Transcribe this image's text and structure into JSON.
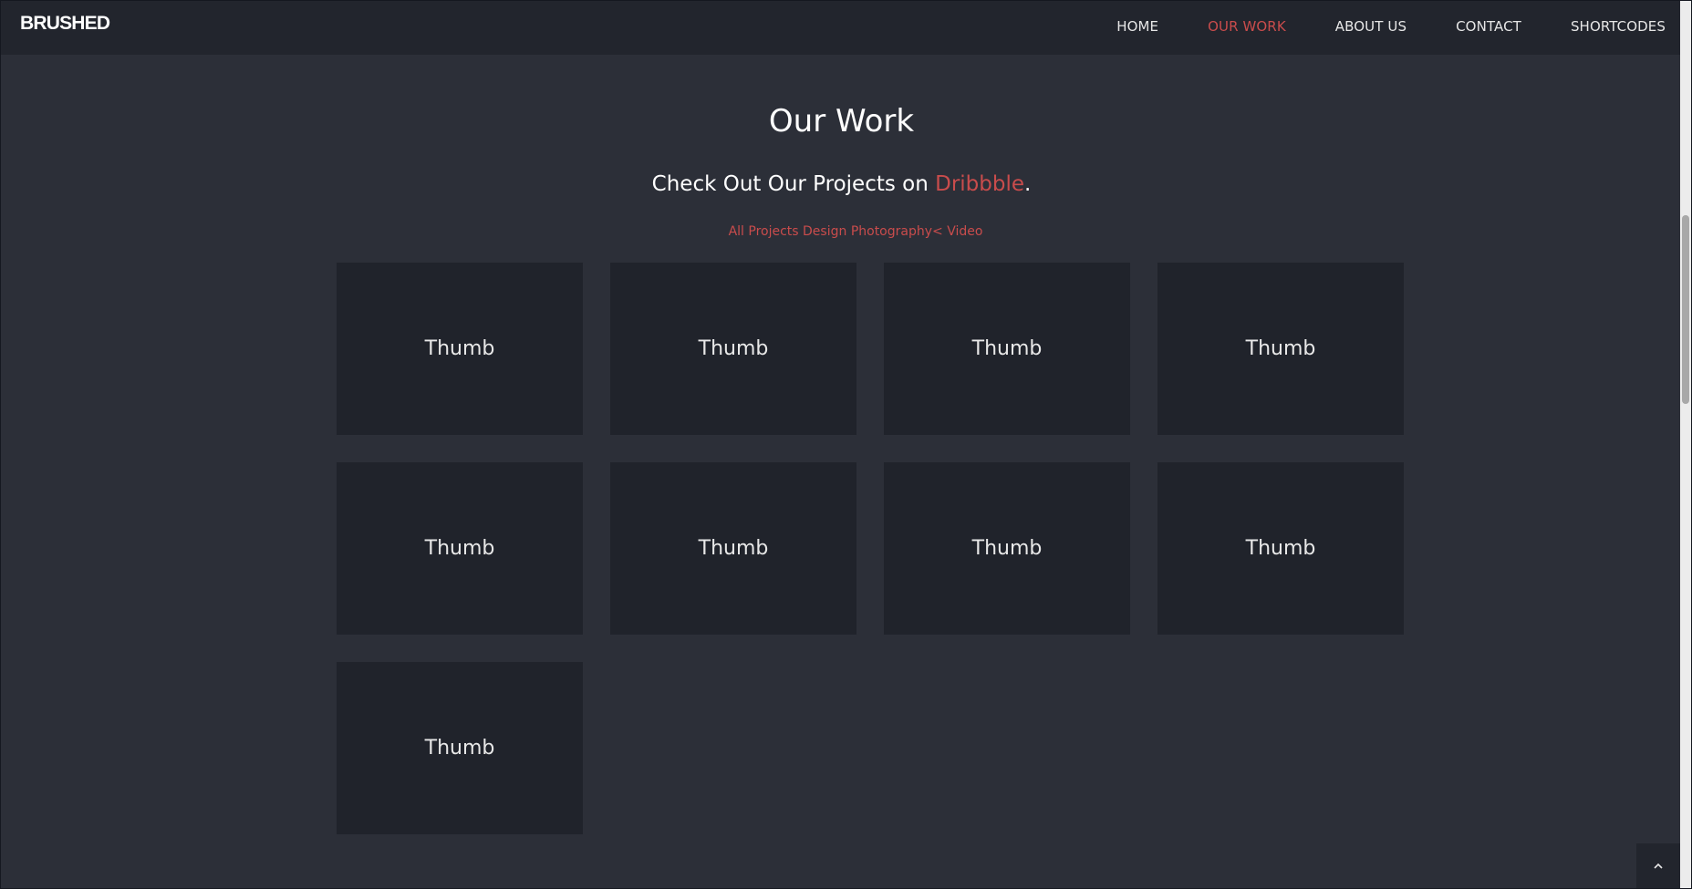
{
  "header": {
    "logo": "BRUSHED",
    "nav": [
      {
        "label": "HOME",
        "active": false
      },
      {
        "label": "OUR WORK",
        "active": true
      },
      {
        "label": "ABOUT US",
        "active": false
      },
      {
        "label": "CONTACT",
        "active": false
      },
      {
        "label": "SHORTCODES",
        "active": false
      }
    ]
  },
  "main": {
    "title": "Our Work",
    "subtitle_prefix": "Check Out Our Projects on ",
    "subtitle_link": "Dribbble",
    "subtitle_suffix": ".",
    "filters": [
      "All Projects",
      "Design",
      "Photography<",
      "Video"
    ],
    "thumbs": [
      "Thumb",
      "Thumb",
      "Thumb",
      "Thumb",
      "Thumb",
      "Thumb",
      "Thumb",
      "Thumb",
      "Thumb"
    ]
  },
  "icons": {
    "back_to_top": "chevron-up-icon"
  },
  "colors": {
    "accent": "#c94c4c",
    "background": "#2c2f38",
    "header": "#22252d",
    "thumb": "#20232b"
  }
}
